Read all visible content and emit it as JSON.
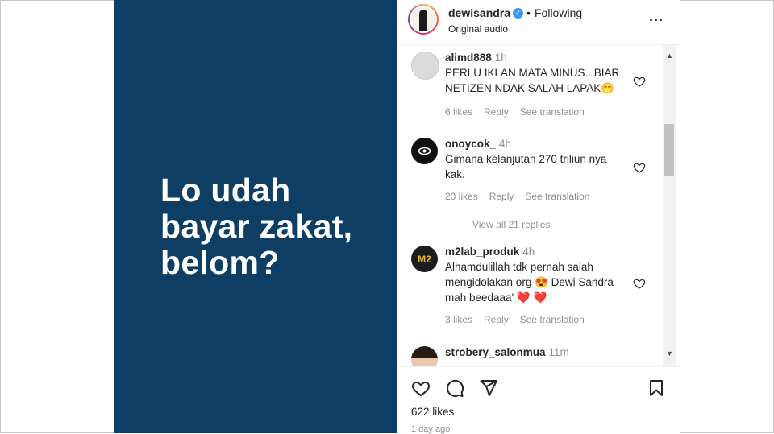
{
  "post": {
    "image_text": [
      "Lo udah",
      "bayar zakat,",
      "belom?"
    ],
    "bg_color": "#0e3e63"
  },
  "header": {
    "username": "dewisandra",
    "verified_icon": "verified-badge-icon",
    "following_label": "Following",
    "audio_label": "Original audio",
    "more_label": "..."
  },
  "comments": [
    {
      "username": "alimd888",
      "time": "1h",
      "text": "PERLU IKLAN MATA MINUS.. BIAR NETIZEN NDAK SALAH LAPAK😁",
      "likes": "6 likes",
      "reply": "Reply",
      "translate": "See translation"
    },
    {
      "username": "onoycok_",
      "time": "4h",
      "text": "Gimana kelanjutan 270 triliun nya kak.",
      "likes": "20 likes",
      "reply": "Reply",
      "translate": "See translation",
      "view_replies": "View all 21 replies"
    },
    {
      "username": "m2lab_produk",
      "time": "4h",
      "text": "Alhamdulillah tdk pernah salah mengidolakan org 😍 Dewi Sandra mah beedaaa' ❤️ ❤️",
      "likes": "3 likes",
      "reply": "Reply",
      "translate": "See translation"
    },
    {
      "username": "strobery_salonmua",
      "time": "11m",
      "text": ""
    }
  ],
  "footer": {
    "likes": "622 likes",
    "time_ago": "1 day ago"
  },
  "colors": {
    "text": "#262626",
    "muted": "#8e8e8e",
    "verified": "#3897f0"
  }
}
